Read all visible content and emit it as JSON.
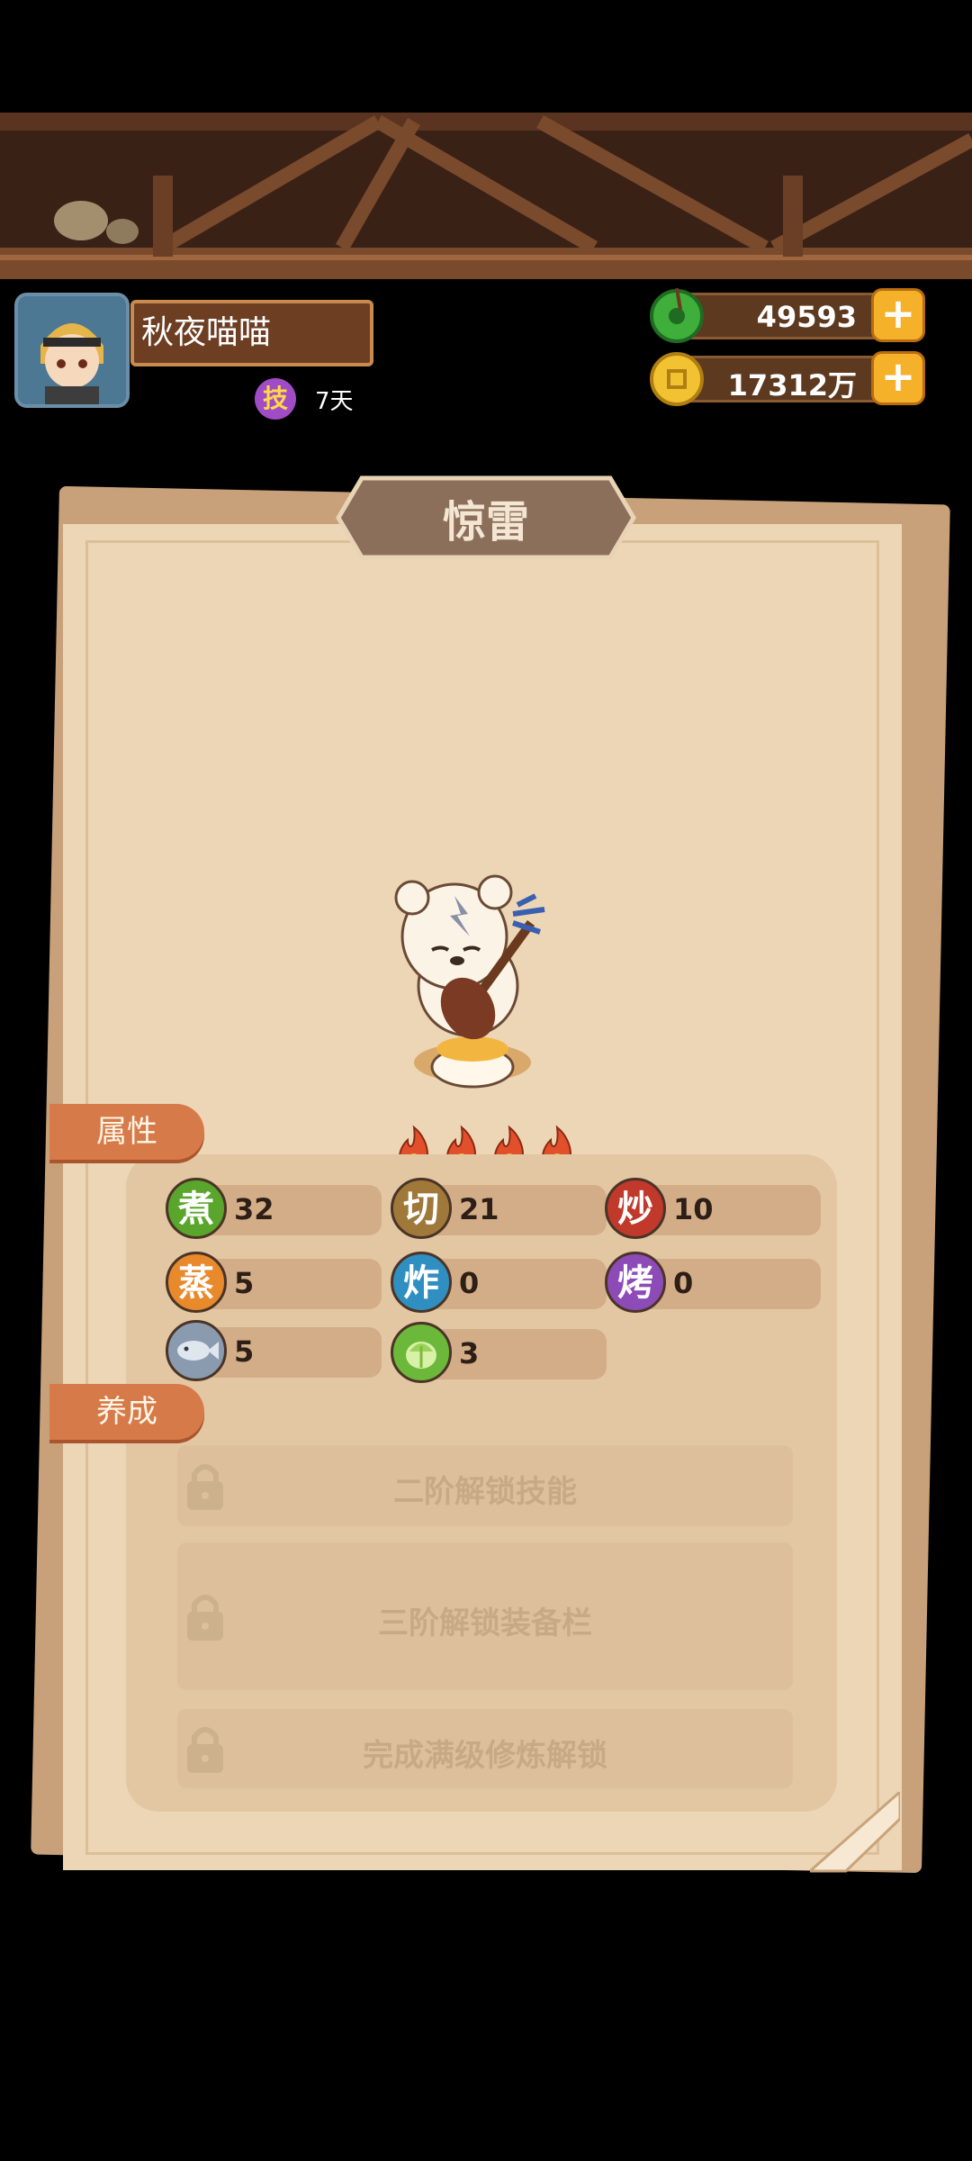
{
  "player": {
    "name": "秋夜喵喵",
    "skill_icon_char": "技",
    "skill_days": "7天"
  },
  "currency": {
    "jade": "49593",
    "coins": "17312万",
    "plus": "+"
  },
  "panel": {
    "title": "惊雷",
    "flame_count": 4,
    "sections": {
      "attributes": "属性",
      "cultivation": "养成"
    },
    "stats": [
      {
        "icon": "煮",
        "value": "32",
        "color": "#5aa52b"
      },
      {
        "icon": "切",
        "value": "21",
        "color": "#a0783a"
      },
      {
        "icon": "炒",
        "value": "10",
        "color": "#c0392b"
      },
      {
        "icon": "蒸",
        "value": "5",
        "color": "#e8892c"
      },
      {
        "icon": "炸",
        "value": "0",
        "color": "#2f8fc1"
      },
      {
        "icon": "烤",
        "value": "0",
        "color": "#8d4bb8"
      },
      {
        "icon": "fish-icon",
        "value": "5",
        "color": "#8a9bb0"
      },
      {
        "icon": "cabbage-icon",
        "value": "3",
        "color": "#6cb83a"
      }
    ],
    "locks": [
      "二阶解锁技能",
      "三阶解锁装备栏",
      "完成满级修炼解锁"
    ]
  },
  "colors": {
    "panel": "#ecd6b6",
    "tab": "#d67a4a",
    "plus_button": "#f5b12a"
  }
}
